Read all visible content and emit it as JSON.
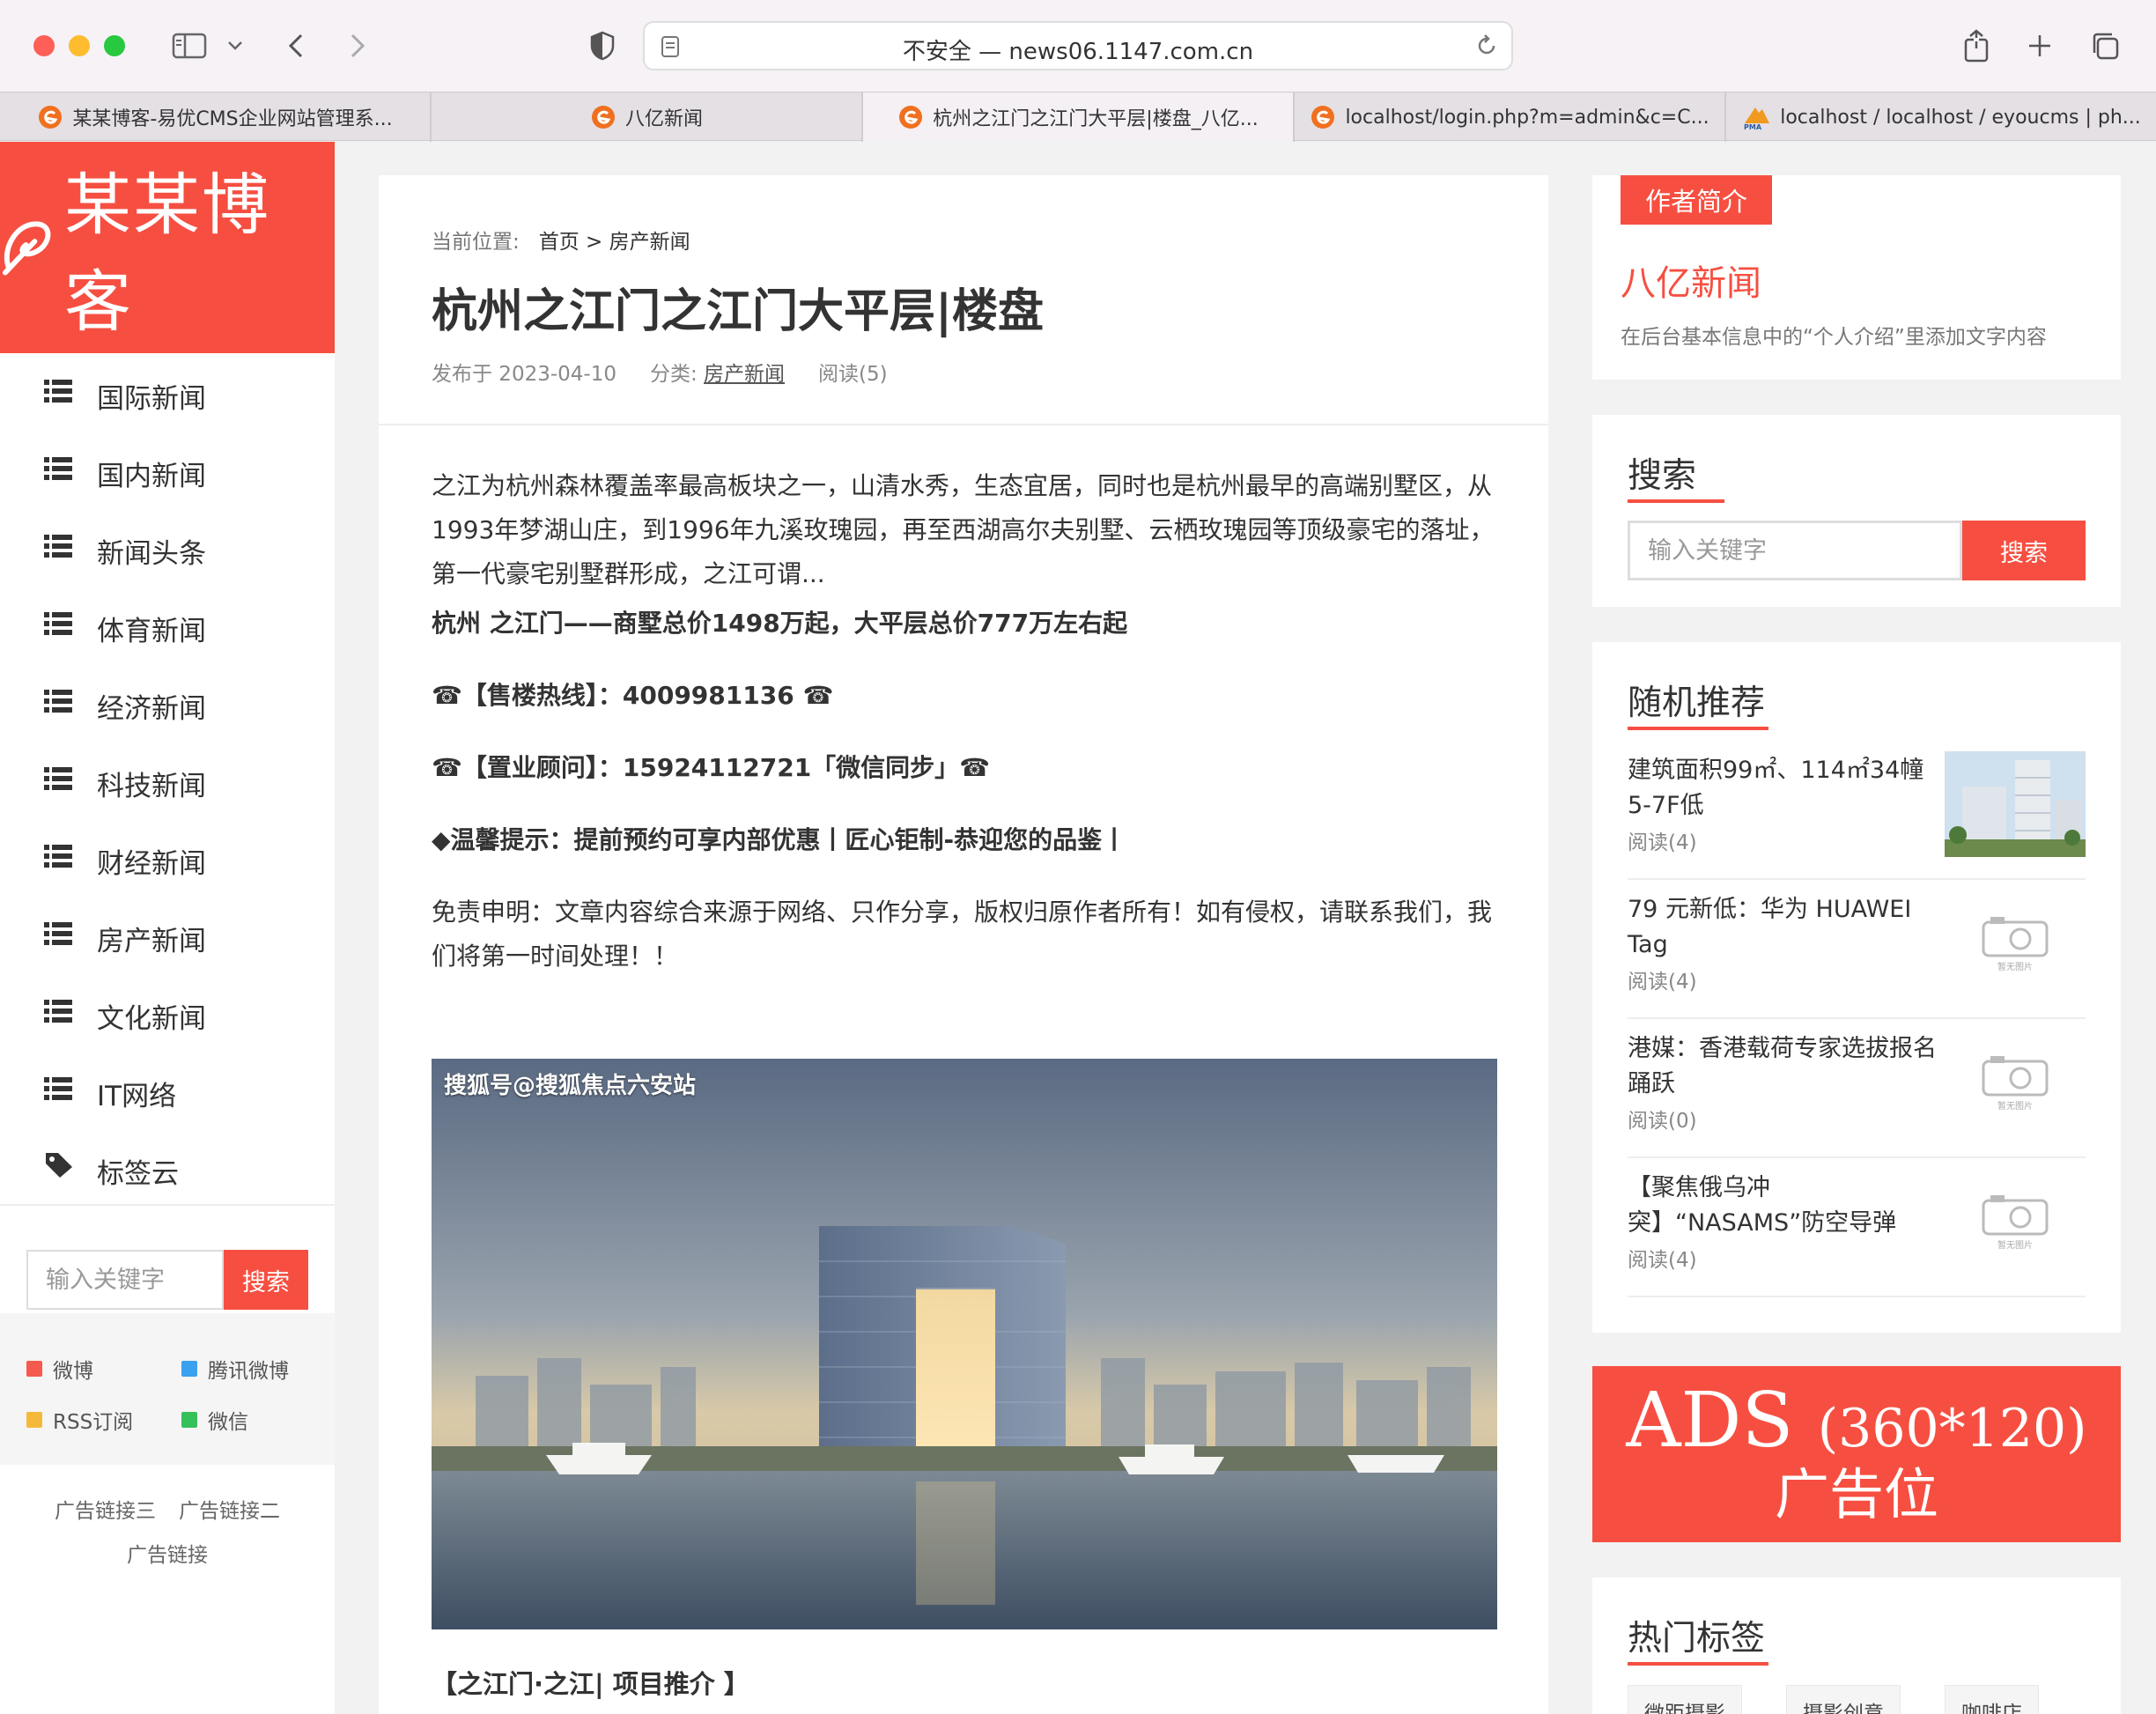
{
  "browser": {
    "url_text": "不安全 — news06.1147.com.cn",
    "tabs": [
      {
        "label": "某某博客-易优CMS企业网站管理系..."
      },
      {
        "label": "八亿新闻"
      },
      {
        "label": "杭州之江门之江门大平层|楼盘_八亿..."
      },
      {
        "label": "localhost/login.php?m=admin&c=C..."
      },
      {
        "label": "localhost / localhost / eyoucms | ph..."
      }
    ],
    "pma_badge": "PMA"
  },
  "sidebar": {
    "logo_text": "某某博客",
    "nav": [
      {
        "label": "国际新闻"
      },
      {
        "label": "国内新闻"
      },
      {
        "label": "新闻头条"
      },
      {
        "label": "体育新闻"
      },
      {
        "label": "经济新闻"
      },
      {
        "label": "科技新闻"
      },
      {
        "label": "财经新闻"
      },
      {
        "label": "房产新闻"
      },
      {
        "label": "文化新闻"
      },
      {
        "label": "IT网络"
      },
      {
        "label": "标签云"
      }
    ],
    "search_placeholder": "输入关键字",
    "search_button": "搜索",
    "social": [
      {
        "label": "微博",
        "color": "#f55a4e"
      },
      {
        "label": "腾讯微博",
        "color": "#3aa0f0"
      },
      {
        "label": "RSS订阅",
        "color": "#f5b93a"
      },
      {
        "label": "微信",
        "color": "#36c05a"
      }
    ],
    "ad_links": [
      "广告链接三",
      "广告链接二",
      "广告链接"
    ]
  },
  "article": {
    "breadcrumb_prefix": "当前位置:",
    "breadcrumb_home": "首页",
    "breadcrumb_sep": ">",
    "breadcrumb_category": "房产新闻",
    "title": "杭州之江门之江门大平层|楼盘",
    "published": "发布于 2023-04-10",
    "category_prefix": "分类:",
    "category": "房产新闻",
    "views": "阅读(5)",
    "paragraphs": [
      "之江为杭州森林覆盖率最高板块之一，山清水秀，生态宜居，同时也是杭州最早的高端别墅区，从1993年梦湖山庄，到1996年九溪玫瑰园，再至西湖高尔夫别墅、云栖玫瑰园等顶级豪宅的落址，第一代豪宅别墅群形成，之江可谓...",
      "杭州 之江门——商墅总价1498万起，大平层总价777万左右起",
      "☎【售楼热线】：4009981136 ☎",
      "☎【置业顾问】：15924112721「微信同步」☎",
      "◆温馨提示：提前预约可享内部优惠丨匠心钜制-恭迎您的品鉴丨",
      "免责申明：文章内容综合来源于网络、只作分享，版权归原作者所有！如有侵权，请联系我们，我们将第一时间处理！！"
    ],
    "image_watermark": "搜狐号@搜狐焦点六安站",
    "sub_heading": "【之江门·之江| 项目推介 】"
  },
  "right": {
    "author_tag": "作者简介",
    "author_name": "八亿新闻",
    "author_desc": "在后台基本信息中的“个人介绍”里添加文字内容",
    "search_title": "搜索",
    "search_placeholder": "输入关键字",
    "search_button": "搜索",
    "random_title": "随机推荐",
    "recommendations": [
      {
        "title": "建筑面积99㎡、114㎡34幢5-7F低",
        "views": "阅读(4)",
        "has_image": true
      },
      {
        "title": "79 元新低：华为 HUAWEI Tag",
        "views": "阅读(4)",
        "has_image": false
      },
      {
        "title": "港媒：香港载荷专家选拔报名踊跃",
        "views": "阅读(0)",
        "has_image": false
      },
      {
        "title": "【聚焦俄乌冲突】“NASAMS”防空导弹",
        "views": "阅读(4)",
        "has_image": false
      }
    ],
    "no_image_text": "暂无图片",
    "ads_line1": "ADS",
    "ads_size": "(360*120)",
    "ads_line2": "广告位",
    "tags_title": "热门标签",
    "tags": [
      "微距摄影",
      "摄影创意",
      "咖啡店"
    ]
  },
  "colors": {
    "accent": "#f64f41"
  }
}
